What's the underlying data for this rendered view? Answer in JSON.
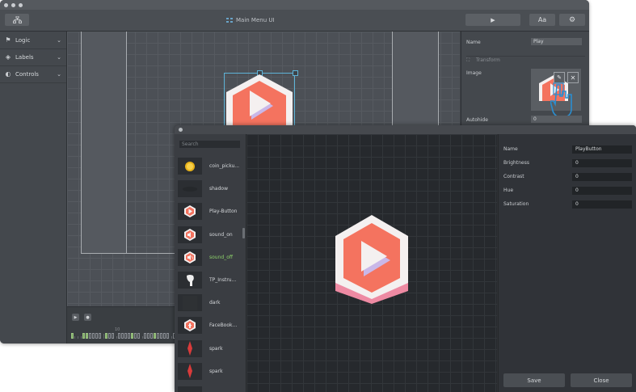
{
  "back_window": {
    "title": "Main Menu UI",
    "toolbar": {
      "font_button_label": "Aa"
    },
    "left_panel": [
      {
        "label": "Logic",
        "icon": "logic-icon"
      },
      {
        "label": "Labels",
        "icon": "tag-icon"
      },
      {
        "label": "Controls",
        "icon": "controls-icon"
      }
    ],
    "properties": {
      "name_label": "Name",
      "name_value": "Play",
      "transform_label": "Transform",
      "image_label": "Image",
      "autohide_label": "Autohide",
      "autohide_value": "0"
    },
    "timeline": {
      "marker": "10"
    }
  },
  "front_window": {
    "search_placeholder": "Search",
    "assets": [
      {
        "name": "coin_picku...",
        "thumb": "coin-icon"
      },
      {
        "name": "shadow",
        "thumb": "shadow-icon"
      },
      {
        "name": "Play-Button",
        "thumb": "play-button-icon"
      },
      {
        "name": "sound_on",
        "thumb": "sound-on-icon"
      },
      {
        "name": "sound_off",
        "thumb": "sound-off-icon",
        "highlight": true
      },
      {
        "name": "TP_Instru...",
        "thumb": "hand-icon"
      },
      {
        "name": "dark",
        "thumb": "dark-icon"
      },
      {
        "name": "FaceBook...",
        "thumb": "facebook-icon"
      },
      {
        "name": "spark",
        "thumb": "spark-icon"
      },
      {
        "name": "spark",
        "thumb": "spark-icon"
      }
    ],
    "properties": [
      {
        "label": "Name",
        "value": "PlayButton"
      },
      {
        "label": "Brightness",
        "value": "0"
      },
      {
        "label": "Contrast",
        "value": "0"
      },
      {
        "label": "Hue",
        "value": "0"
      },
      {
        "label": "Saturation",
        "value": "0"
      }
    ],
    "save_label": "Save",
    "close_label": "Close"
  },
  "colors": {
    "hex_coral": "#f4735f",
    "hex_white": "#f4f0f0",
    "hex_pink": "#ee8aa3",
    "play_purple": "#c9b7e8",
    "selection": "#5fb4d8",
    "green_text": "#8cd06a"
  }
}
